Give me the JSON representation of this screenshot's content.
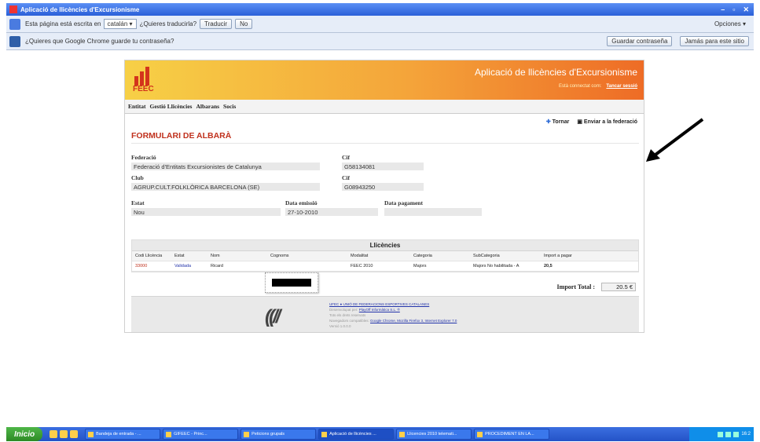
{
  "window": {
    "title": "Aplicació de llicències d'Excursionisme"
  },
  "translate_bar": {
    "text_before": "Esta página está escrita en",
    "language": "catalán",
    "question": "¿Quieres traducirla?",
    "translate_btn": "Traducir",
    "no_btn": "No",
    "options_btn": "Opciones"
  },
  "password_bar": {
    "text": "¿Quieres que Google Chrome guarde tu contraseña?",
    "save_btn": "Guardar contraseña",
    "never_btn": "Jamás para este sitio"
  },
  "app": {
    "logo_text": "FEEC",
    "title": "Aplicació de llicències d'Excursionisme",
    "user_text": "Està connectat com: ",
    "logout": "Tancar sessió",
    "menu": [
      "Entitat",
      "Gestió Llicències",
      "Albarans",
      "Socis"
    ],
    "actions": {
      "back": "Tornar",
      "send": "Enviar a la federació"
    },
    "form_title": "FORMULARI DE ALBARÀ",
    "fields": {
      "federacio_label": "Federació",
      "federacio_value": "Federació d'Entitats Excursionistes de Catalunya",
      "cif1_label": "Cif",
      "cif1_value": "G58134081",
      "club_label": "Club",
      "club_value": "AGRUP.CULT.FOLKLÒRICA BARCELONA (SE)",
      "cif2_label": "Cif",
      "cif2_value": "G08943250",
      "estat_label": "Estat",
      "estat_value": "Nou",
      "emissio_label": "Data emissió",
      "emissio_value": "27-10-2010",
      "pagament_label": "Data pagament",
      "pagament_value": ""
    },
    "licences": {
      "title": "Llicències",
      "headers": [
        "Codi Llicència",
        "Estat",
        "Nom",
        "Cognoms",
        "Modalitat",
        "Categoria",
        "SubCategoria",
        "Import a pagar"
      ],
      "rows": [
        [
          "33000",
          "Validada",
          "Ricard",
          "",
          "FEEC 2010",
          "Majors",
          "Majors No habilitada - A",
          "20,5"
        ]
      ]
    },
    "total_label": "Import Total :",
    "total_value": "20.5 €",
    "footer": {
      "line1": "UFEC ● UNIÓ DE FEDERACIONS ESPORTIVES CATALANES",
      "line2": "Desenvolupat per: ",
      "dev": "PlayOff Informàtica S.L. ®",
      "line3": "Tots els drets reservats",
      "line4": "Navegadors compatibles: ",
      "browsers": "Google Chrome, Mozilla Firefox 3, Internet Explorer 7.0",
      "line5": "Versió 1.0.0.0"
    }
  },
  "taskbar": {
    "start": "Inicio",
    "tasks": [
      "Bandeja de entrada - ...",
      "GIFEEC - Princ...",
      "Peticions grupals",
      "Aplicació de llicències ...",
      "Llicencies 2010 telemati...",
      "PROCEDIMENT EN LA..."
    ],
    "clock": "16:2"
  }
}
